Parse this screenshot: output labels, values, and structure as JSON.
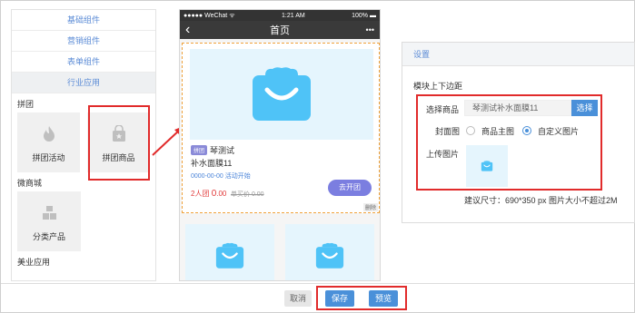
{
  "left_panel": {
    "categories": [
      "基础组件",
      "营销组件",
      "表单组件",
      "行业应用"
    ],
    "groups": [
      {
        "title": "拼团",
        "items": [
          "拼团活动",
          "拼团商品"
        ]
      },
      {
        "title": "微商城",
        "items": [
          "分类产品"
        ]
      },
      {
        "title": "美业应用",
        "items": []
      }
    ]
  },
  "phone": {
    "status_left": "●●●●● WeChat ᯤ",
    "status_time": "1:21 AM",
    "status_right": "100% ▬",
    "nav_back": "‹",
    "nav_title": "首页",
    "nav_more": "•••",
    "product": {
      "tag": "拼团",
      "title": "琴测试",
      "name": "补水面膜11",
      "date": "0000-00-00 活动开始",
      "price_label": "2人团",
      "price_big": "0",
      "price_small": ".00",
      "old_price": "单买价 0.00",
      "button": "去开团",
      "delete": "删除"
    }
  },
  "settings": {
    "header": "设置",
    "margin_label": "模块上下边距",
    "select_label": "选择商品",
    "select_value": "琴测试补水面膜11",
    "select_button": "选择",
    "cover_label": "封面图",
    "cover_options": [
      "商品主图",
      "自定义图片"
    ],
    "cover_selected": 1,
    "upload_label": "上传图片",
    "hint": "建议尺寸：690*350 px 图片大小不超过2M"
  },
  "footer": {
    "cancel": "取消",
    "save": "保存",
    "preview": "预览"
  },
  "colors": {
    "accent": "#4a90d9",
    "highlight": "#e12b2b",
    "icon_blue": "#4fc3f7"
  }
}
